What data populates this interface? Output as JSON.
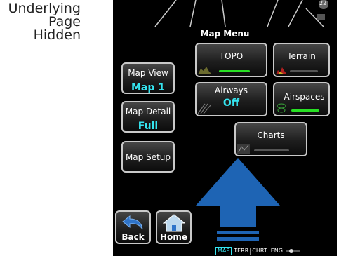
{
  "annotation": {
    "text_line1": "Underlying",
    "text_line2": "Page",
    "text_line3": "Hidden"
  },
  "menu": {
    "title": "Map Menu"
  },
  "buttons": {
    "map_view": {
      "label": "Map View",
      "value": "Map 1"
    },
    "map_detail": {
      "label": "Map Detail",
      "value": "Full"
    },
    "map_setup": {
      "label": "Map Setup"
    },
    "topo": {
      "label": "TOPO",
      "enabled": true
    },
    "terrain": {
      "label": "Terrain",
      "enabled": false
    },
    "airways": {
      "label": "Airways",
      "value": "Off"
    },
    "airspaces": {
      "label": "Airspaces",
      "enabled": true
    },
    "charts": {
      "label": "Charts",
      "enabled": false
    },
    "back": {
      "label": "Back",
      "icon": "back-arrow-icon"
    },
    "home": {
      "label": "Home",
      "icon": "home-icon"
    }
  },
  "status_bar": {
    "tabs": [
      "MAP",
      "TERR",
      "CHRT",
      "ENG"
    ],
    "active": "MAP"
  },
  "background_badge": "22",
  "colors": {
    "value_cyan": "#35e5f0",
    "on_green": "#28e024",
    "arrow_blue": "#1e64b4"
  }
}
